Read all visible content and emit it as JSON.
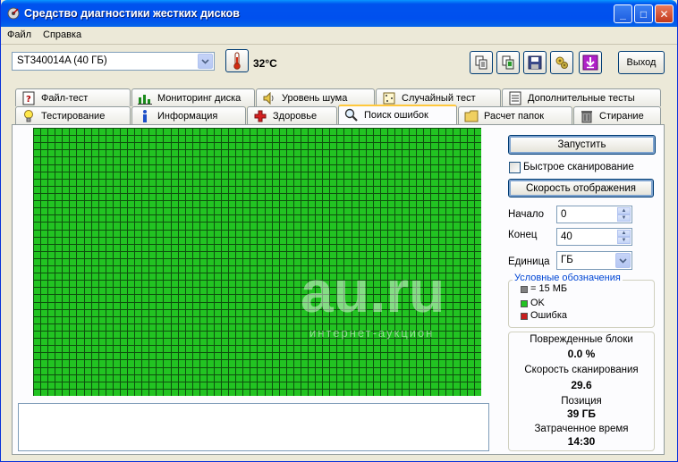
{
  "window": {
    "title": "Средство диагностики жестких дисков",
    "minimize_glyph": "_",
    "maximize_glyph": "□",
    "close_glyph": "✕"
  },
  "menu": {
    "file": "Файл",
    "help": "Справка"
  },
  "toolbar": {
    "drive": "ST340014A (40 ГБ)",
    "temperature": "32°C",
    "exit_label": "Выход",
    "icons": [
      "copy-icon",
      "copy-report-icon",
      "save-icon",
      "settings-icon",
      "down-arrow-icon"
    ]
  },
  "tabs_top": [
    {
      "label": "Файл-тест",
      "icon": "file-test-icon"
    },
    {
      "label": "Мониторинг диска",
      "icon": "chart-icon"
    },
    {
      "label": "Уровень шума",
      "icon": "speaker-icon"
    },
    {
      "label": "Случайный тест",
      "icon": "random-icon"
    },
    {
      "label": "Дополнительные тесты",
      "icon": "doc-icon"
    }
  ],
  "tabs_bottom": [
    {
      "label": "Тестирование",
      "icon": "bulb-icon"
    },
    {
      "label": "Информация",
      "icon": "info-icon"
    },
    {
      "label": "Здоровье",
      "icon": "health-cross-icon"
    },
    {
      "label": "Поиск ошибок",
      "icon": "magnifier-icon",
      "active": true
    },
    {
      "label": "Расчет папок",
      "icon": "folder-icon"
    },
    {
      "label": "Стирание",
      "icon": "trash-icon"
    }
  ],
  "scan": {
    "start_button": "Запустить",
    "quick_scan_label": "Быстрое сканирование",
    "quick_scan_checked": false,
    "speed_button": "Скорость отображения",
    "start_label": "Начало",
    "start_value": "0",
    "end_label": "Конец",
    "end_value": "40",
    "unit_label": "Единица",
    "unit_value": "ГБ"
  },
  "legend": {
    "title": "Условные обозначения",
    "items": [
      {
        "label": "= 15 МБ",
        "color": "#808080"
      },
      {
        "label": "OK",
        "color": "#22c322"
      },
      {
        "label": "Ошибка",
        "color": "#c81e1e"
      }
    ]
  },
  "stats": {
    "damaged_label": "Поврежденные блоки",
    "damaged_value": "0.0 %",
    "speed_label": "Скорость сканирования",
    "speed_value": "29.6",
    "position_label": "Позиция",
    "position_value": "39 ГБ",
    "elapsed_label": "Затраченное время",
    "elapsed_value": "14:30"
  },
  "colors": {
    "block_ok": "#22c322",
    "grid_line": "#0e4f0e",
    "title_bar": "#0053ee"
  },
  "blocks": {
    "status": "all-ok"
  },
  "watermark": {
    "text": "au.ru",
    "subtext": "интернет-аукцион"
  }
}
